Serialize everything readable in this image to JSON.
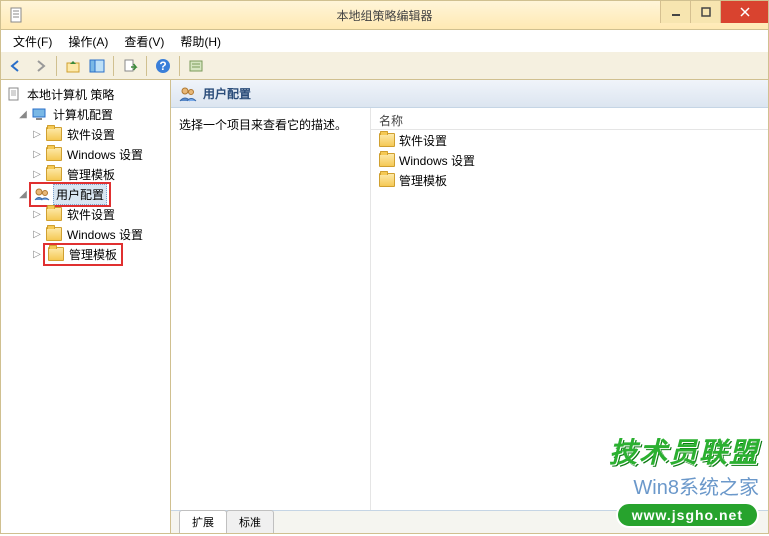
{
  "window": {
    "title": "本地组策略编辑器"
  },
  "menu": {
    "file": "文件(F)",
    "action": "操作(A)",
    "view": "查看(V)",
    "help": "帮助(H)"
  },
  "tree": {
    "root": "本地计算机 策略",
    "computer": "计算机配置",
    "software": "软件设置",
    "windows": "Windows 设置",
    "admin": "管理模板",
    "user": "用户配置"
  },
  "panel": {
    "heading": "用户配置",
    "desc": "选择一个项目来查看它的描述。",
    "colname": "名称",
    "items": {
      "software": "软件设置",
      "windows": "Windows 设置",
      "admin": "管理模板"
    }
  },
  "tabs": {
    "extended": "扩展",
    "standard": "标准"
  },
  "watermark": {
    "line1": "技术员联盟",
    "line2": "Win8系统之家",
    "line3": "www.jsgho.net"
  }
}
